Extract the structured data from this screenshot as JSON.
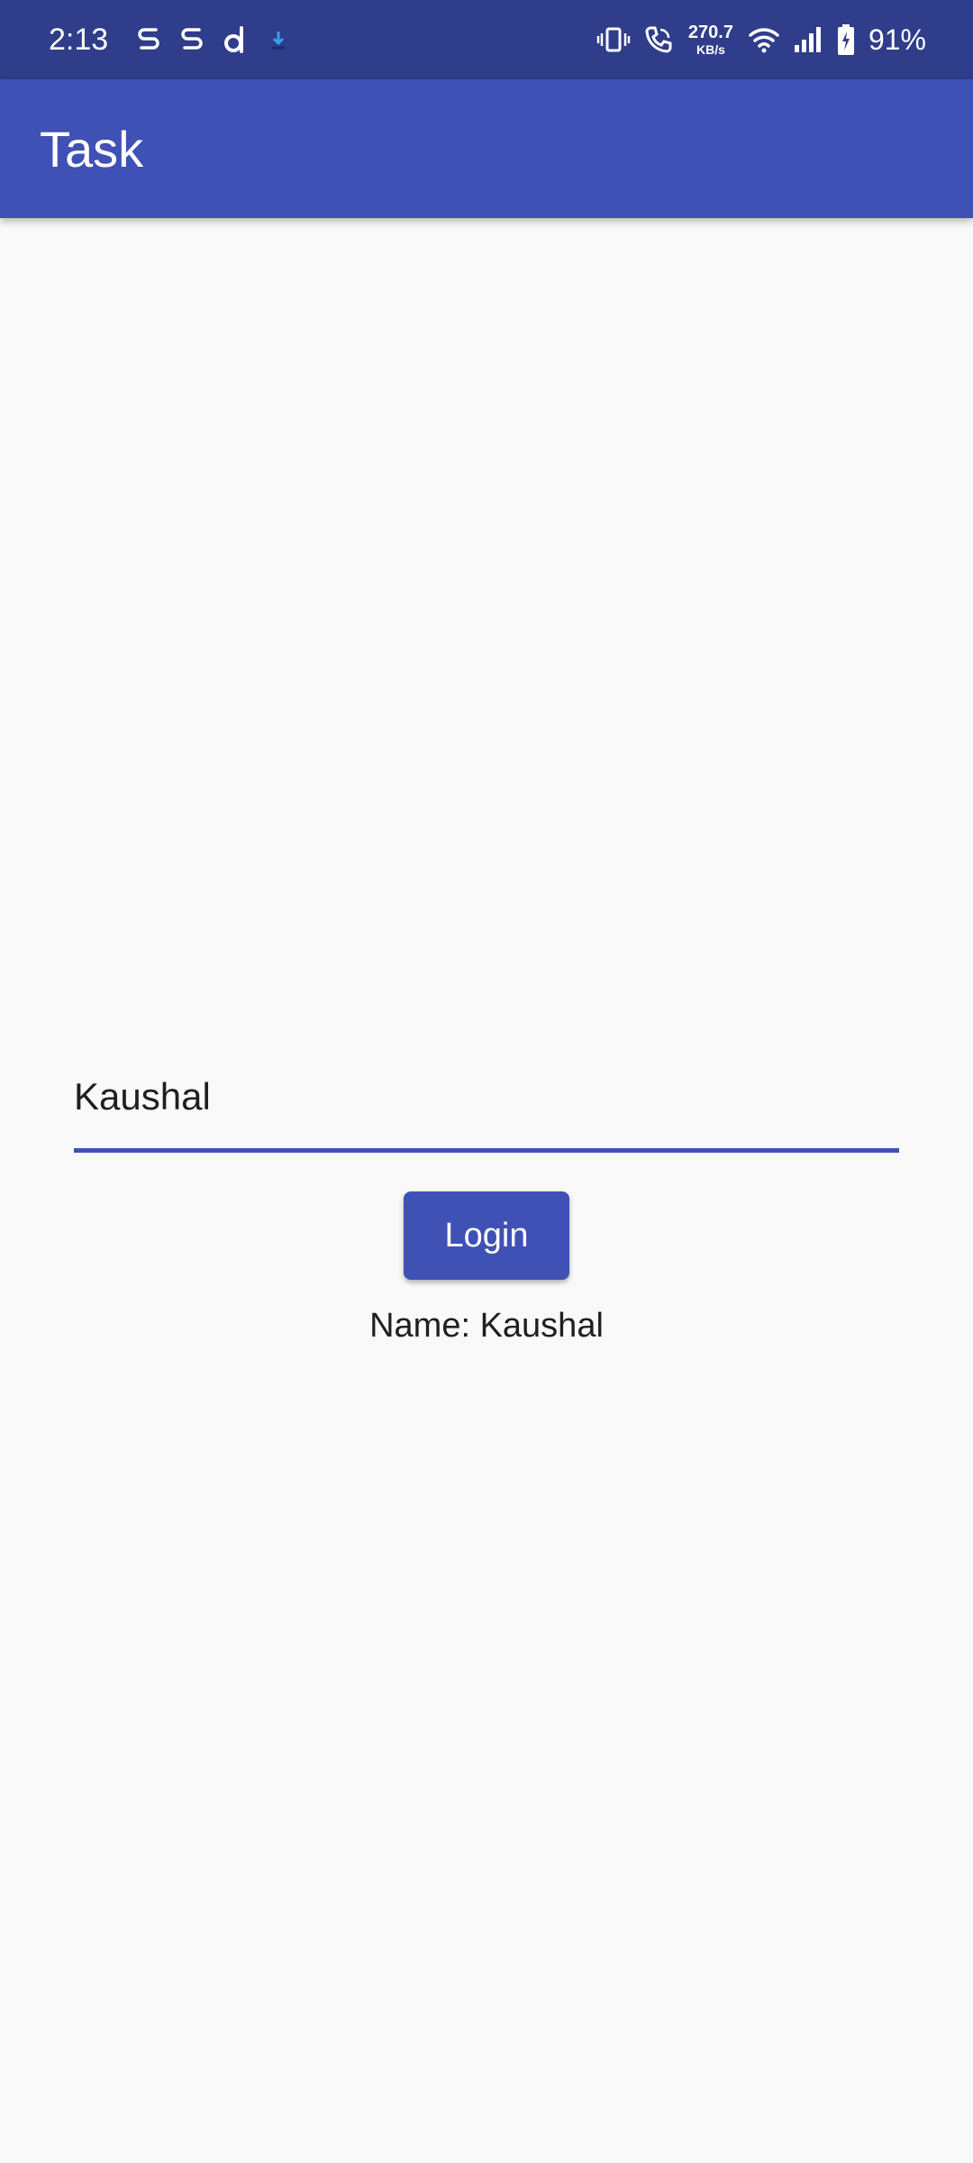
{
  "status_bar": {
    "time": "2:13",
    "notification_icons": [
      "notification-s-icon",
      "notification-s-icon",
      "notification-d-icon",
      "download-icon"
    ],
    "system_icons": [
      "vibrate-icon",
      "call-icon",
      "wifi-icon",
      "signal-icon",
      "battery-charging-icon"
    ],
    "net_speed_value": "270.7",
    "net_speed_unit": "KB/s",
    "battery": "91%"
  },
  "app_bar": {
    "title": "Task"
  },
  "form": {
    "name_value": "Kaushal",
    "login_label": "Login",
    "result_text": "Name: Kaushal"
  },
  "colors": {
    "primary": "#3F51B5",
    "status_bar": "#2F3D8A",
    "background": "#FAF9FA",
    "text": "#1F1F1F"
  }
}
